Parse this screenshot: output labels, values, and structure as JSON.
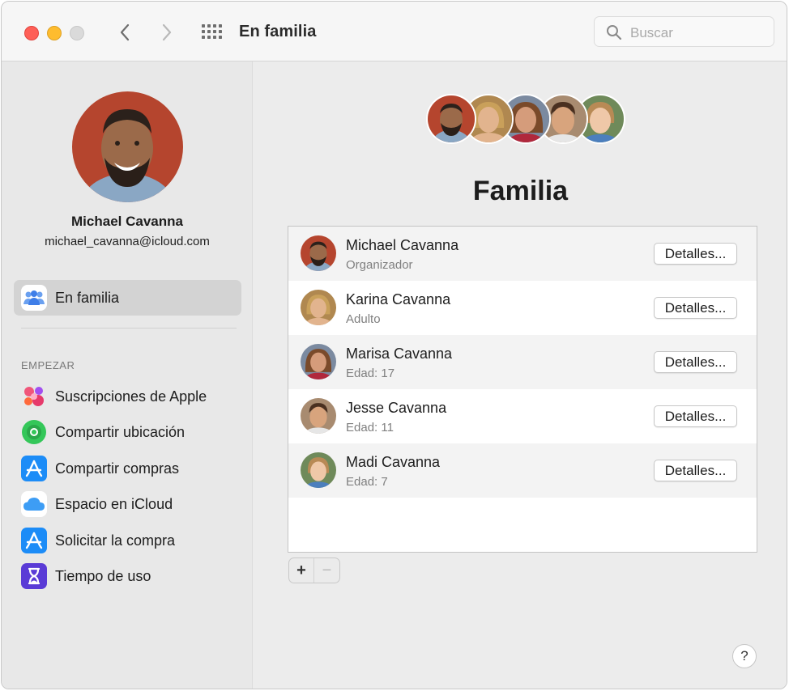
{
  "window": {
    "title": "En familia",
    "search_placeholder": "Buscar",
    "icons": {
      "close": "close-window-icon",
      "minimize": "minimize-window-icon",
      "zoom": "zoom-window-icon",
      "back": "chevron-left-icon",
      "forward": "chevron-right-icon",
      "grid": "grid-icon",
      "search": "search-icon"
    }
  },
  "sidebar": {
    "profile": {
      "name": "Michael Cavanna",
      "email": "michael_cavanna@icloud.com"
    },
    "selected_item": {
      "label": "En familia",
      "icon": "family-icon"
    },
    "section_label": "EMPEZAR",
    "items": [
      {
        "label": "Suscripciones de Apple",
        "icon": "subscriptions-icon"
      },
      {
        "label": "Compartir ubicación",
        "icon": "find-my-icon"
      },
      {
        "label": "Compartir compras",
        "icon": "app-store-icon"
      },
      {
        "label": "Espacio en iCloud",
        "icon": "icloud-icon"
      },
      {
        "label": "Solicitar la compra",
        "icon": "app-store-icon"
      },
      {
        "label": "Tiempo de uso",
        "icon": "hourglass-icon"
      }
    ]
  },
  "main": {
    "title": "Familia",
    "members": [
      {
        "name": "Michael Cavanna",
        "role": "Organizador",
        "button": "Detalles..."
      },
      {
        "name": "Karina Cavanna",
        "role": "Adulto",
        "button": "Detalles..."
      },
      {
        "name": "Marisa Cavanna",
        "role": "Edad: 17",
        "button": "Detalles..."
      },
      {
        "name": "Jesse Cavanna",
        "role": "Edad: 11",
        "button": "Detalles..."
      },
      {
        "name": "Madi Cavanna",
        "role": "Edad: 7",
        "button": "Detalles..."
      }
    ],
    "add_label": "+",
    "remove_label": "−",
    "help_label": "?"
  },
  "colors": {
    "close": "#fe5f57",
    "minimize": "#febc2e",
    "zoom": "#dadada",
    "sidebar_bg": "#e8e8e8",
    "selected_bg": "#d3d3d3"
  }
}
